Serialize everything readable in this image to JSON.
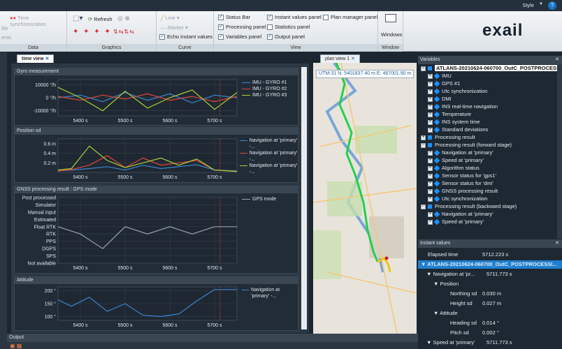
{
  "topbar": {
    "style_label": "Style",
    "help_icon": "?"
  },
  "ribbon": {
    "data_group": {
      "label": "Data",
      "items": [
        "file",
        "ents"
      ],
      "time_sync": "Time synchronization"
    },
    "graphics_group": {
      "label": "Graphics",
      "refresh": "Refresh"
    },
    "curve_group": {
      "label": "Curve",
      "line": "Line",
      "marker": "Marker",
      "echo": "Echo instant values"
    },
    "view_group": {
      "label": "View",
      "checks": [
        {
          "label": "Status Bar",
          "checked": true
        },
        {
          "label": "Processing panel",
          "checked": true
        },
        {
          "label": "Variables panel",
          "checked": true
        },
        {
          "label": "Instant values panel",
          "checked": true
        },
        {
          "label": "Statistics panel",
          "checked": false
        },
        {
          "label": "Output panel",
          "checked": true
        },
        {
          "label": "Plan manager panel",
          "checked": false
        }
      ]
    },
    "window_group": {
      "label": "Window",
      "windows": "Windows"
    },
    "logo": "exail"
  },
  "tabs": {
    "time_view": "time view",
    "plan_view": "plan view 1"
  },
  "utm": {
    "zone": "UTM-31",
    "north": "N: 5401837.40 m",
    "east": "E: 467001.90 m"
  },
  "charts": {
    "gyro": {
      "title": "Gyro measurement",
      "yticks": [
        "10000 °/h",
        "0 °/h",
        "-10000 °/h"
      ],
      "legend": [
        "IMU - GYRO #1",
        "IMU - GYRO #2",
        "IMU - GYRO #3"
      ]
    },
    "position": {
      "title": "Position sd",
      "yticks": [
        "0.6 m",
        "0.4 m",
        "0.2 m"
      ],
      "legend": [
        "Navigation at 'primary' -...",
        "Navigation at 'primary' -...",
        "Navigation at 'primary' -..."
      ]
    },
    "gnss": {
      "title": "GNSS processing result : GPS mode",
      "yticks": [
        "Post processed",
        "Simulator",
        "Manual input",
        "Estimated",
        "Float RTK",
        "RTK",
        "PPS",
        "DGPS",
        "SPS",
        "Not available"
      ],
      "legend": [
        "GPS mode"
      ]
    },
    "attitude": {
      "title": "Attitude",
      "yticks": [
        "200 °",
        "150 °",
        "100 °"
      ],
      "legend": [
        "Navigation at 'primary' -..."
      ]
    },
    "xticks": [
      "5400 s",
      "5500 s",
      "5600 s",
      "5700 s"
    ],
    "colors": {
      "blue": "#3a86d4",
      "red": "#e0443a",
      "green": "#a8cf3a",
      "gnss": "#9aa3ab",
      "cursor": "#c0393b"
    }
  },
  "chart_data": [
    {
      "type": "line",
      "title": "Gyro measurement",
      "x": [
        5350,
        5400,
        5450,
        5500,
        5550,
        5600,
        5650,
        5700,
        5750
      ],
      "series": [
        {
          "name": "IMU - GYRO #1",
          "values": [
            0,
            2000,
            -3000,
            4000,
            -2000,
            3000,
            -4000,
            2000,
            0
          ]
        },
        {
          "name": "IMU - GYRO #2",
          "values": [
            1000,
            -2000,
            2000,
            -1000,
            3000,
            -2000,
            1000,
            -3000,
            1000
          ]
        },
        {
          "name": "IMU - GYRO #3",
          "values": [
            8000,
            0,
            -10000,
            5000,
            -8000,
            0,
            6000,
            -9000,
            4000
          ]
        }
      ]
    },
    {
      "type": "line",
      "title": "Position sd",
      "x": [
        5350,
        5380,
        5420,
        5460,
        5500,
        5540,
        5580,
        5620,
        5660,
        5700,
        5750
      ],
      "series": [
        {
          "name": "Navigation at 'primary' -...",
          "values": [
            0.03,
            0.05,
            0.08,
            0.12,
            0.05,
            0.15,
            0.08,
            0.12,
            0.16,
            0.05,
            0.03
          ]
        },
        {
          "name": "Navigation at 'primary' -...",
          "values": [
            0.03,
            0.06,
            0.15,
            0.35,
            0.1,
            0.3,
            0.15,
            0.2,
            0.25,
            0.05,
            0.02
          ]
        },
        {
          "name": "Navigation at 'primary' -...",
          "values": [
            0.05,
            0.08,
            0.55,
            0.25,
            0.1,
            0.2,
            0.3,
            0.15,
            0.28,
            0.05,
            0.02
          ]
        }
      ]
    },
    {
      "type": "line",
      "title": "GNSS processing result : GPS mode",
      "x": [
        5350,
        5400,
        5450,
        5500,
        5550,
        5600,
        5650,
        5700,
        5750
      ],
      "series": [
        {
          "name": "GPS mode",
          "values": [
            "Float RTK",
            "RTK",
            "DGPS",
            "Float RTK",
            "RTK",
            "Float RTK",
            "RTK",
            "Float RTK",
            "Float RTK"
          ]
        }
      ]
    },
    {
      "type": "line",
      "title": "Attitude",
      "x": [
        5350,
        5380,
        5420,
        5460,
        5500,
        5540,
        5580,
        5620,
        5660,
        5700,
        5750
      ],
      "series": [
        {
          "name": "Navigation at 'primary' -...",
          "values": [
            165,
            140,
            175,
            120,
            150,
            105,
            100,
            110,
            160,
            205,
            205
          ]
        }
      ]
    }
  ],
  "variables": {
    "title": "Variables",
    "items": [
      {
        "depth": 0,
        "label": "ATLANS-20210624-060700_OutC_POSTPROCESSI...",
        "kind": "root",
        "selected": true
      },
      {
        "depth": 1,
        "label": "IMU",
        "kind": "dia"
      },
      {
        "depth": 1,
        "label": "GPS #1",
        "kind": "dia"
      },
      {
        "depth": 1,
        "label": "Utc synchronization",
        "kind": "dia"
      },
      {
        "depth": 1,
        "label": "DMI",
        "kind": "dia"
      },
      {
        "depth": 1,
        "label": "INS real-time navigation",
        "kind": "dia"
      },
      {
        "depth": 1,
        "label": "Temperature",
        "kind": "dia"
      },
      {
        "depth": 1,
        "label": "INS system time",
        "kind": "dia"
      },
      {
        "depth": 1,
        "label": "Standard deviations",
        "kind": "dia"
      },
      {
        "depth": 0,
        "label": "Processing result",
        "kind": "sq"
      },
      {
        "depth": 0,
        "label": "Processing result (forward stage)",
        "kind": "sq",
        "open": true
      },
      {
        "depth": 1,
        "label": "Navigation at 'primary'",
        "kind": "dia"
      },
      {
        "depth": 1,
        "label": "Speed at 'primary'",
        "kind": "dia"
      },
      {
        "depth": 1,
        "label": "Algorithm status",
        "kind": "dia"
      },
      {
        "depth": 1,
        "label": "Sensor status for 'gps1'",
        "kind": "dia"
      },
      {
        "depth": 1,
        "label": "Sensor status for 'dmi'",
        "kind": "dia"
      },
      {
        "depth": 1,
        "label": "GNSS processing result",
        "kind": "dia"
      },
      {
        "depth": 1,
        "label": "Utc synchronization",
        "kind": "dia"
      },
      {
        "depth": 0,
        "label": "Processing result (backward stage)",
        "kind": "sq",
        "open": true
      },
      {
        "depth": 1,
        "label": "Navigation at 'primary'",
        "kind": "dia"
      },
      {
        "depth": 1,
        "label": "Speed at 'primary'",
        "kind": "dia"
      }
    ]
  },
  "instant": {
    "title": "Instant values",
    "elapsed_label": "Elapsed time",
    "elapsed_value": "5712.223 s",
    "root": "ATLANS-20210624-060700_OutC_POSTPROCESSI...",
    "nav_label": "Navigation at 'pr...",
    "nav_value": "5711.773 s",
    "position": "Position",
    "northing_label": "Northing sd",
    "northing_value": "0.030 m",
    "height_label": "Height sd",
    "height_value": "0.027 m",
    "attitude": "Attitude",
    "heading_label": "Heading sd",
    "heading_value": "0.014 °",
    "pitch_label": "Pitch sd",
    "pitch_value": "0.002 °",
    "speed_label": "Speed at 'primary'",
    "speed_value": "5711.773 s"
  },
  "output": {
    "title": "Output"
  }
}
